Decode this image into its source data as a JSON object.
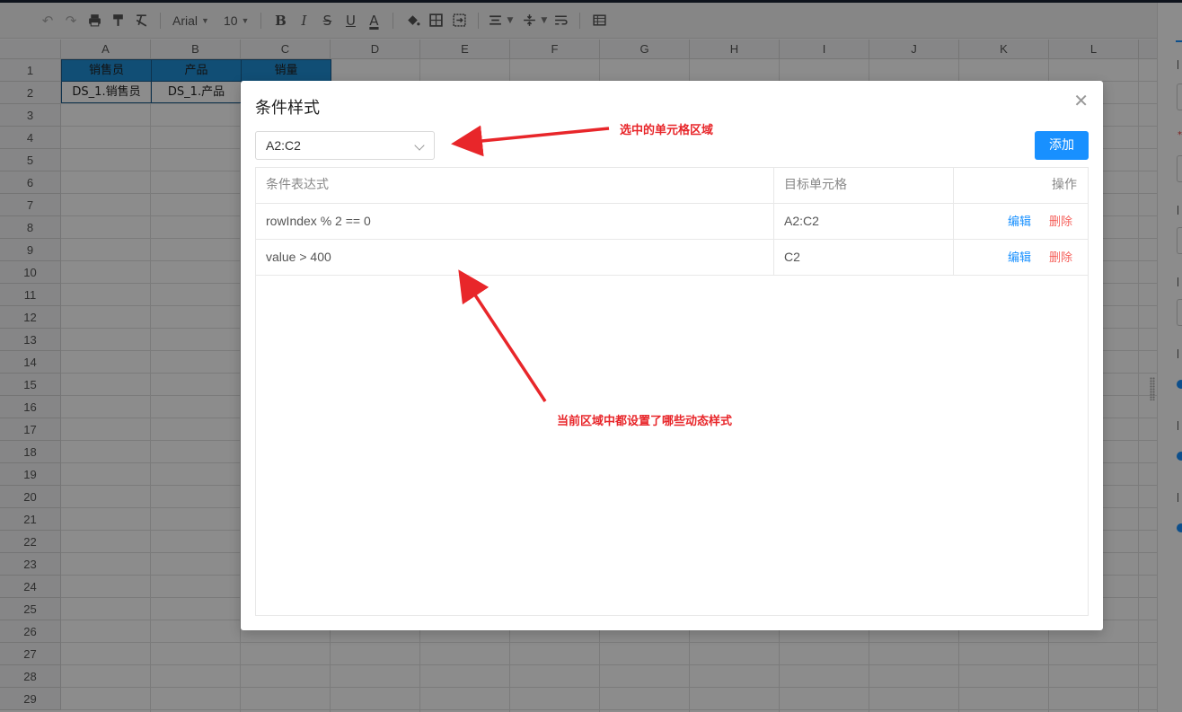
{
  "toolbar": {
    "font_name": "Arial",
    "font_size": "10",
    "items": [
      "undo-icon",
      "redo-icon",
      "print-icon",
      "format-painter-icon",
      "clear-format-icon",
      "bold-icon",
      "italic-icon",
      "strikethrough-icon",
      "underline-icon",
      "font-color-icon",
      "fill-color-icon",
      "border-icon",
      "merge-cells-icon",
      "align-horizontal-icon",
      "align-vertical-icon",
      "wrap-text-icon",
      "table-icon"
    ]
  },
  "sheet": {
    "columns": [
      "A",
      "B",
      "C",
      "D",
      "E",
      "F",
      "G",
      "H",
      "I",
      "J",
      "K",
      "L"
    ],
    "rows": [
      "1",
      "2",
      "3",
      "4",
      "5",
      "6",
      "7",
      "8",
      "9",
      "10",
      "11",
      "12",
      "13",
      "14",
      "15",
      "16",
      "17",
      "18",
      "19",
      "20",
      "21",
      "22",
      "23",
      "24",
      "25",
      "26",
      "27",
      "28",
      "29"
    ],
    "header_cells": [
      "销售员",
      "产品",
      "销量"
    ],
    "value_cells": [
      "DS_1.销售员",
      "DS_1.产品"
    ],
    "header_color": "#1f8fd6"
  },
  "dialog": {
    "title": "条件样式",
    "close_icon": "close-icon",
    "range_select": {
      "value": "A2:C2"
    },
    "add_label": "添加",
    "table": {
      "headers": [
        "条件表达式",
        "目标单元格",
        "操作"
      ],
      "rows": [
        {
          "expression": "rowIndex % 2 == 0",
          "target": "A2:C2",
          "edit": "编辑",
          "delete": "删除"
        },
        {
          "expression": "value > 400",
          "target": "C2",
          "edit": "编辑",
          "delete": "删除"
        }
      ]
    }
  },
  "annotations": {
    "selected_range_note": "选中的单元格区域",
    "styles_note": "当前区域中都设置了哪些动态样式",
    "color": "#e8262a"
  },
  "colors": {
    "primary": "#1890ff",
    "danger": "#f5605b"
  }
}
